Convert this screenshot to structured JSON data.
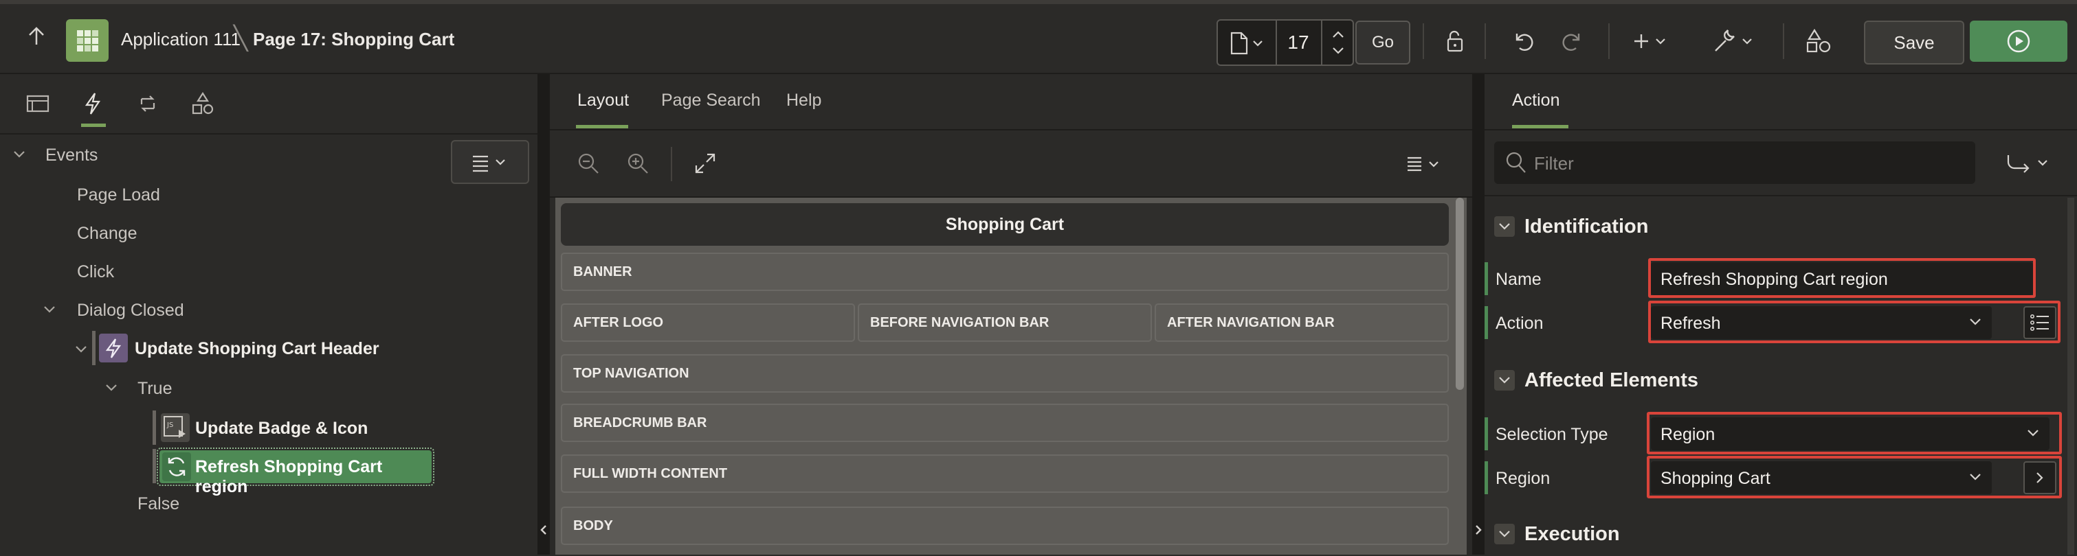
{
  "header": {
    "app_name": "Application 111",
    "page_name": "Page 17: Shopping Cart",
    "page_number": "17",
    "go_label": "Go",
    "save_label": "Save"
  },
  "left": {
    "tree": [
      {
        "label": "Events",
        "level": 0,
        "bold": false
      },
      {
        "label": "Page Load",
        "level": 1
      },
      {
        "label": "Change",
        "level": 1
      },
      {
        "label": "Click",
        "level": 1
      },
      {
        "label": "Dialog Closed",
        "level": 1
      },
      {
        "label": "Update Shopping Cart Header",
        "level": 2,
        "bold": true
      },
      {
        "label": "True",
        "level": 3
      },
      {
        "label": "Update Badge & Icon",
        "level": 4,
        "bold": true
      },
      {
        "label": "Refresh Shopping Cart region",
        "level": 4,
        "bold": true,
        "selected": true
      },
      {
        "label": "False",
        "level": 3
      }
    ]
  },
  "center": {
    "tabs": [
      "Layout",
      "Page Search",
      "Help"
    ],
    "page_title": "Shopping Cart",
    "regions": {
      "banner": "BANNER",
      "after_logo": "AFTER LOGO",
      "before_nav": "BEFORE NAVIGATION BAR",
      "after_nav": "AFTER NAVIGATION BAR",
      "top_nav": "TOP NAVIGATION",
      "breadcrumb": "BREADCRUMB BAR",
      "full_width": "FULL WIDTH CONTENT",
      "body": "BODY"
    }
  },
  "right": {
    "tab": "Action",
    "filter_placeholder": "Filter",
    "sections": {
      "identification": "Identification",
      "affected": "Affected Elements",
      "execution": "Execution"
    },
    "fields": {
      "name_label": "Name",
      "name_value": "Refresh Shopping Cart region",
      "action_label": "Action",
      "action_value": "Refresh",
      "selection_type_label": "Selection Type",
      "selection_type_value": "Region",
      "region_label": "Region",
      "region_value": "Shopping Cart"
    }
  },
  "colors": {
    "accent_green": "#7aa15a",
    "run_green": "#4f8c57",
    "highlight_red": "#d9443a",
    "selected_node": "#4e8a55"
  },
  "icons": [
    "up-arrow-icon",
    "app-icon",
    "page-icon",
    "lock-icon",
    "undo-icon",
    "redo-icon",
    "plus-icon",
    "wrench-icon",
    "shapes-icon",
    "run-icon",
    "rendering-icon",
    "dynamic-actions-icon",
    "processing-icon",
    "shared-components-icon",
    "zoom-out-icon",
    "zoom-in-icon",
    "expand-icon",
    "menu-icon",
    "search-icon",
    "goto-icon",
    "lightning-icon",
    "javascript-icon",
    "refresh-icon",
    "list-icon",
    "chevron-right-icon"
  ]
}
